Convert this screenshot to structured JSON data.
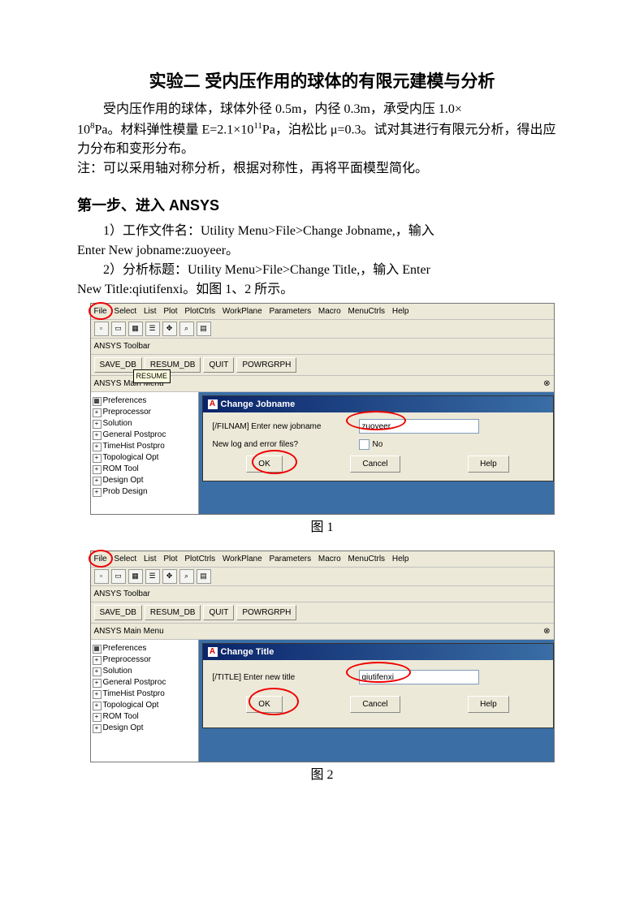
{
  "title": "实验二 受内压作用的球体的有限元建模与分析",
  "intro_1a": "受内压作用的球体，球体外径 0.5m，内径 0.3m，承受内压 1.0×",
  "intro_1b": "Pa。材料弹性模量 E=2.1×10",
  "intro_1c": "Pa，泊松比 μ=0.3。试对其进行有限元分析，得出应力分布和变形分布。",
  "sup8": "8",
  "sup11": "11",
  "note": "注：可以采用轴对称分析，根据对称性，再将平面模型简化。",
  "step1_heading": "第一步、进入 ANSYS",
  "step1_1a": "1）工作文件名：Utility Menu>File>Change Jobname,，输入",
  "step1_1b": "Enter New jobname:zuoyeer。",
  "step1_2a": "2）分析标题：Utility Menu>File>Change Title,，输入 Enter",
  "step1_2b": "New Title:qiutifenxi。如图 1、2 所示。",
  "fig1_caption": "图 1",
  "fig2_caption": "图 2",
  "ansys": {
    "menu": [
      "File",
      "Select",
      "List",
      "Plot",
      "PlotCtrls",
      "WorkPlane",
      "Parameters",
      "Macro",
      "MenuCtrls",
      "Help"
    ],
    "toolbar_label": "ANSYS Toolbar",
    "btns": [
      "SAVE_DB",
      "RESUM_DB",
      "QUIT",
      "POWRGRPH"
    ],
    "main_menu_label": "ANSYS Main Menu",
    "tree1": [
      "Preferences",
      "Preprocessor",
      "Solution",
      "General Postproc",
      "TimeHist Postpro",
      "Topological Opt",
      "ROM Tool",
      "Design Opt",
      "Prob Design"
    ],
    "tree2": [
      "Preferences",
      "Preprocessor",
      "Solution",
      "General Postproc",
      "TimeHist Postpro",
      "Topological Opt",
      "ROM Tool",
      "Design Opt"
    ],
    "dlg1": {
      "title": "Change Jobname",
      "row1_lbl": "[/FILNAM] Enter new jobname",
      "row1_val": "zuoyeer",
      "row2_lbl": "New log and error files?",
      "row2_val": "No",
      "ok": "OK",
      "cancel": "Cancel",
      "help": "Help"
    },
    "dlg2": {
      "title": "Change Title",
      "row1_lbl": "[/TITLE] Enter new title",
      "row1_val": "qiutifenxi",
      "ok": "OK",
      "cancel": "Cancel",
      "help": "Help"
    },
    "tooltip": "RESUME"
  }
}
